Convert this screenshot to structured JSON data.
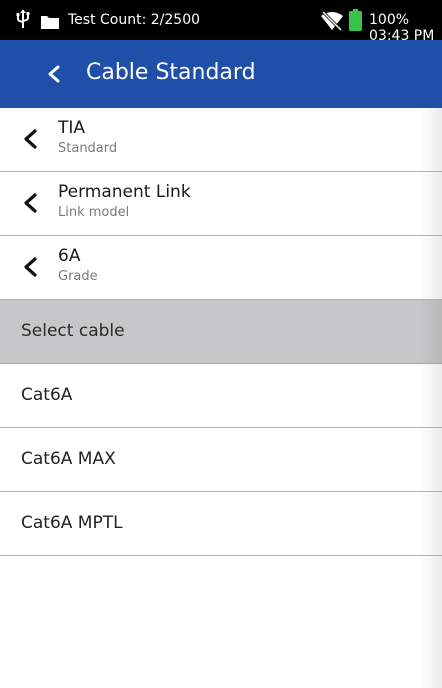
{
  "status_bar": {
    "test_count": "Test Count: 2/2500",
    "battery_time": "100% 03:43 PM",
    "icons": [
      "usb-icon",
      "folder-icon",
      "wifi-off-icon",
      "battery-icon"
    ]
  },
  "header": {
    "title": "Cable Standard",
    "back_icon": "chevron-left-icon"
  },
  "settings": [
    {
      "value": "TIA",
      "label": "Standard"
    },
    {
      "value": "Permanent Link",
      "label": "Link model"
    },
    {
      "value": "6A",
      "label": "Grade"
    }
  ],
  "section_title": "Select cable",
  "cables": [
    "Cat6A",
    "Cat6A MAX",
    "Cat6A MPTL"
  ],
  "colors": {
    "header_bg": "#1f4fa8",
    "status_bg": "#000000",
    "section_bg": "#c7c7c9",
    "battery": "#39c24a"
  }
}
